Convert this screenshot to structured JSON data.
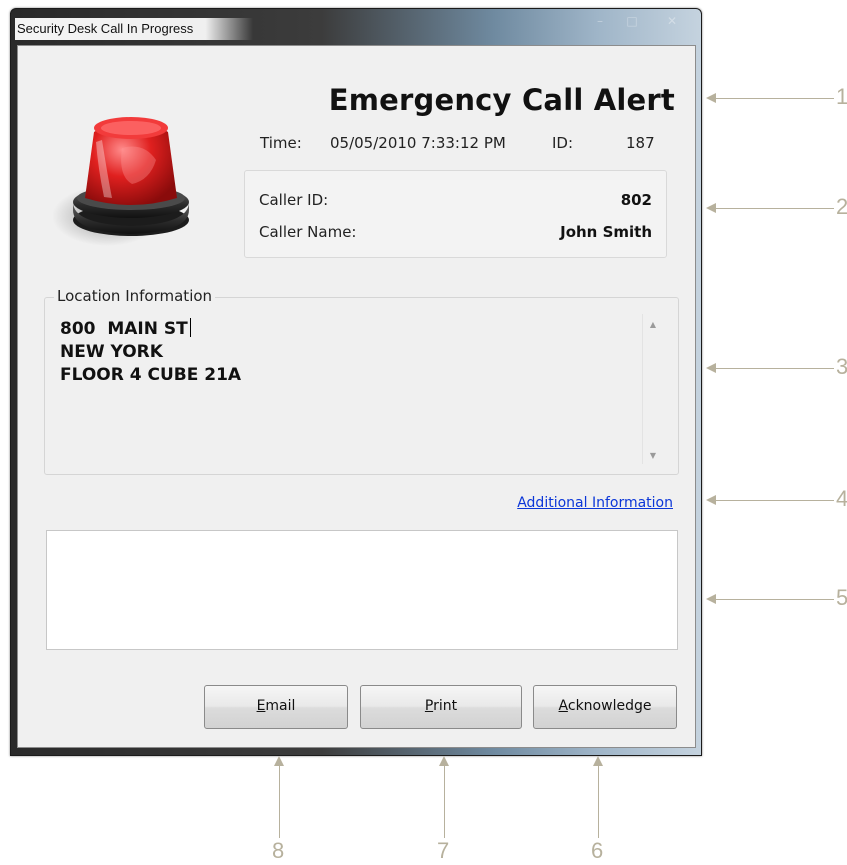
{
  "window": {
    "title": "Security Desk Call In Progress"
  },
  "alert": {
    "title": "Emergency Call Alert",
    "time_label": "Time:",
    "time_value": "05/05/2010 7:33:12 PM",
    "id_label": "ID:",
    "id_value": "187"
  },
  "caller": {
    "id_label": "Caller ID:",
    "id_value": "802",
    "name_label": "Caller Name:",
    "name_value": "John Smith"
  },
  "location": {
    "legend": "Location Information",
    "lines": [
      "800  MAIN ST",
      "NEW YORK",
      "FLOOR 4 CUBE 21A"
    ]
  },
  "additional_info_link": "Additional Information",
  "notes_text": "",
  "buttons": {
    "email_mnemonic": "E",
    "email_rest": "mail",
    "print_mnemonic": "P",
    "print_rest": "rint",
    "ack_mnemonic": "A",
    "ack_rest": "cknowledge"
  },
  "callouts": [
    "1",
    "2",
    "3",
    "4",
    "5",
    "6",
    "7",
    "8"
  ],
  "colors": {
    "callout": "#b7b19d",
    "link": "#0b36d8",
    "siren_red": "#d81c1c"
  },
  "icons": {
    "siren": "red-siren-icon",
    "scroll_up": "scroll-up-arrow",
    "scroll_down": "scroll-down-arrow"
  }
}
